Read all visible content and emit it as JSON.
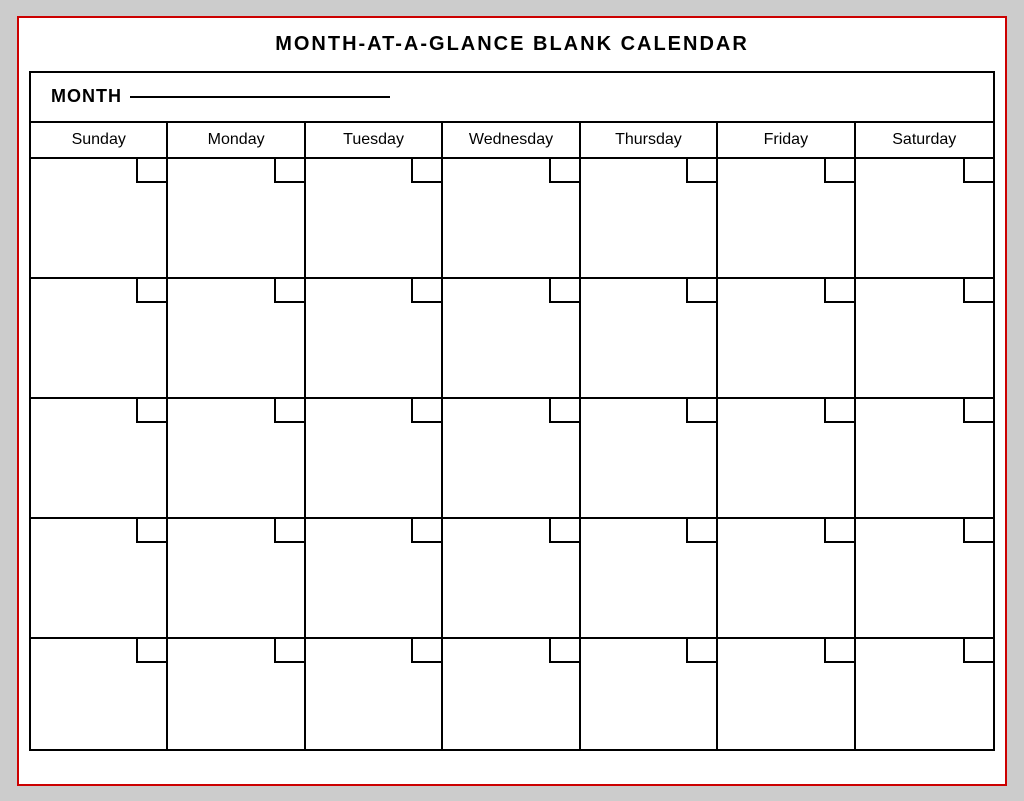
{
  "page": {
    "title": "MONTH-AT-A-GLANCE  BLANK  CALENDAR",
    "month_label": "MONTH",
    "days": [
      "Sunday",
      "Monday",
      "Tuesday",
      "Wednesday",
      "Thursday",
      "Friday",
      "Saturday"
    ],
    "rows": 5
  }
}
